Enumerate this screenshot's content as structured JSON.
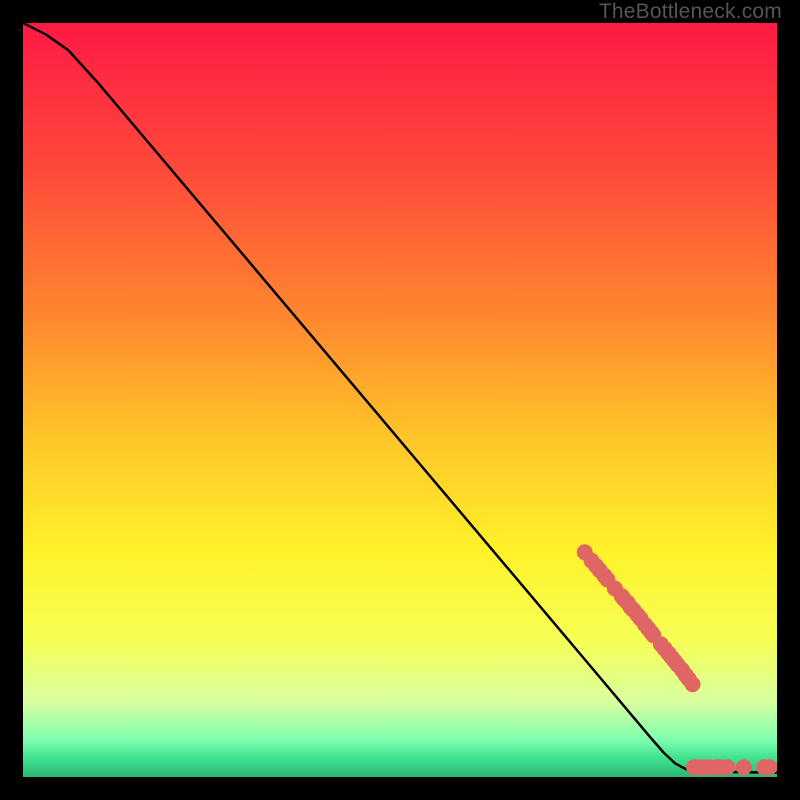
{
  "watermark": "TheBottleneck.com",
  "chart_data": {
    "type": "line",
    "title": "",
    "xlabel": "",
    "ylabel": "",
    "xlim": [
      0,
      100
    ],
    "ylim": [
      0,
      100
    ],
    "background_gradient": {
      "stops": [
        {
          "offset": 0.0,
          "color": "#ff1a44"
        },
        {
          "offset": 0.2,
          "color": "#ff4b3a"
        },
        {
          "offset": 0.4,
          "color": "#ff8b2e"
        },
        {
          "offset": 0.55,
          "color": "#ffc529"
        },
        {
          "offset": 0.7,
          "color": "#fff22a"
        },
        {
          "offset": 0.82,
          "color": "#f6ff56"
        },
        {
          "offset": 0.9,
          "color": "#d9ffa0"
        },
        {
          "offset": 0.95,
          "color": "#7fffb0"
        },
        {
          "offset": 0.975,
          "color": "#3fe28f"
        },
        {
          "offset": 1.0,
          "color": "#2bb673"
        }
      ]
    },
    "series": [
      {
        "name": "curve",
        "type": "line",
        "color": "#000000",
        "points": [
          {
            "x": 0.0,
            "y": 100.0
          },
          {
            "x": 3.0,
            "y": 98.5
          },
          {
            "x": 6.0,
            "y": 96.4
          },
          {
            "x": 10.0,
            "y": 92.0
          },
          {
            "x": 74.5,
            "y": 15.6
          },
          {
            "x": 83.0,
            "y": 5.5
          },
          {
            "x": 85.0,
            "y": 3.2
          },
          {
            "x": 86.5,
            "y": 1.8
          },
          {
            "x": 88.0,
            "y": 1.0
          },
          {
            "x": 89.5,
            "y": 0.7
          },
          {
            "x": 100.0,
            "y": 0.6
          }
        ]
      },
      {
        "name": "dots",
        "type": "scatter",
        "color": "#e06666",
        "radius_units": "px",
        "radius": 8,
        "points": [
          {
            "x": 74.5,
            "y": 29.8
          },
          {
            "x": 75.4,
            "y": 28.7
          },
          {
            "x": 76.0,
            "y": 28.0
          },
          {
            "x": 76.5,
            "y": 27.4
          },
          {
            "x": 77.1,
            "y": 26.7
          },
          {
            "x": 77.5,
            "y": 26.2
          },
          {
            "x": 78.5,
            "y": 25.0
          },
          {
            "x": 79.4,
            "y": 24.0
          },
          {
            "x": 79.7,
            "y": 23.6
          },
          {
            "x": 80.2,
            "y": 23.1
          },
          {
            "x": 80.6,
            "y": 22.5
          },
          {
            "x": 81.0,
            "y": 22.1
          },
          {
            "x": 81.5,
            "y": 21.5
          },
          {
            "x": 81.9,
            "y": 21.0
          },
          {
            "x": 82.5,
            "y": 20.2
          },
          {
            "x": 82.9,
            "y": 19.7
          },
          {
            "x": 83.3,
            "y": 19.2
          },
          {
            "x": 83.6,
            "y": 18.8
          },
          {
            "x": 84.6,
            "y": 17.6
          },
          {
            "x": 85.1,
            "y": 17.0
          },
          {
            "x": 85.6,
            "y": 16.4
          },
          {
            "x": 86.0,
            "y": 15.9
          },
          {
            "x": 86.4,
            "y": 15.4
          },
          {
            "x": 86.8,
            "y": 14.9
          },
          {
            "x": 87.4,
            "y": 14.2
          },
          {
            "x": 87.9,
            "y": 13.5
          },
          {
            "x": 88.3,
            "y": 13.0
          },
          {
            "x": 88.8,
            "y": 12.3
          },
          {
            "x": 89.0,
            "y": 1.3
          },
          {
            "x": 89.7,
            "y": 1.3
          },
          {
            "x": 90.3,
            "y": 1.3
          },
          {
            "x": 91.0,
            "y": 1.3
          },
          {
            "x": 92.0,
            "y": 1.3
          },
          {
            "x": 92.4,
            "y": 1.3
          },
          {
            "x": 93.4,
            "y": 1.3
          },
          {
            "x": 95.6,
            "y": 1.3
          },
          {
            "x": 98.3,
            "y": 1.3
          },
          {
            "x": 99.0,
            "y": 1.3
          }
        ]
      }
    ]
  }
}
